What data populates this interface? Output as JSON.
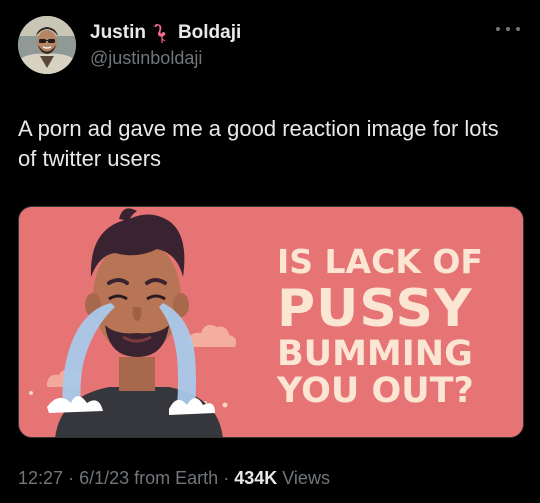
{
  "author": {
    "name_first": "Justin",
    "name_last": "Boldaji",
    "name_emoji": "flamingo-emoji",
    "handle": "@justinboldaji",
    "avatar": "profile-photo"
  },
  "tweet": {
    "text": "A porn ad gave me a good reaction image for lots of twitter users"
  },
  "media": {
    "headline_line1": "IS LACK OF",
    "headline_line2": "PUSSY",
    "headline_line3": "BUMMING",
    "headline_line4": "YOU OUT?",
    "background_color": "#e77474",
    "text_color": "#fbe5d3"
  },
  "meta": {
    "time": "12:27",
    "separator1": "·",
    "date": "6/1/23",
    "source": "from Earth",
    "separator2": "·",
    "views_count": "434K",
    "views_label": "Views"
  },
  "icons": {
    "more": "more-horizontal-icon"
  }
}
